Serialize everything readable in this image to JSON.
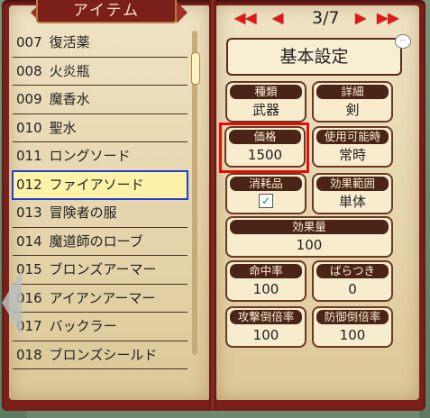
{
  "title": "アイテム",
  "items": [
    {
      "number": "007",
      "name": "復活薬"
    },
    {
      "number": "008",
      "name": "火炎瓶"
    },
    {
      "number": "009",
      "name": "魔香水"
    },
    {
      "number": "010",
      "name": "聖水"
    },
    {
      "number": "011",
      "name": "ロングソード"
    },
    {
      "number": "012",
      "name": "ファイアソード"
    },
    {
      "number": "013",
      "name": "冒険者の服"
    },
    {
      "number": "014",
      "name": "魔道師のローブ"
    },
    {
      "number": "015",
      "name": "ブロンズアーマー"
    },
    {
      "number": "016",
      "name": "アイアンアーマー"
    },
    {
      "number": "017",
      "name": "バックラー"
    },
    {
      "number": "018",
      "name": "ブロンズシールド"
    }
  ],
  "selected_index": 5,
  "nav": {
    "first": "◀◀",
    "prev": "◀",
    "page": "3/7",
    "next": "▶",
    "last": "▶▶"
  },
  "section_title": "基本設定",
  "info_badge": "···",
  "fields": {
    "type": {
      "label": "種類",
      "value": "武器"
    },
    "detail": {
      "label": "詳細",
      "value": "剣"
    },
    "price": {
      "label": "価格",
      "value": "1500"
    },
    "usable_when": {
      "label": "使用可能時",
      "value": "常時"
    },
    "consumable": {
      "label": "消耗品",
      "checked": true,
      "check_glyph": "✓"
    },
    "scope": {
      "label": "効果範囲",
      "value": "単体"
    },
    "effect": {
      "label": "効果量",
      "value": "100"
    },
    "hit_rate": {
      "label": "命中率",
      "value": "100"
    },
    "variance": {
      "label": "ばらつき",
      "value": "0"
    },
    "atk_mult": {
      "label": "攻撃倒倍率",
      "value": "100"
    },
    "def_mult": {
      "label": "防御倒倍率",
      "value": "100"
    }
  },
  "colors": {
    "selection_outline": "#2140d0",
    "highlight_box": "#e20d0d",
    "nav_arrows": "#e01818",
    "cover": "#7a1f1a"
  }
}
